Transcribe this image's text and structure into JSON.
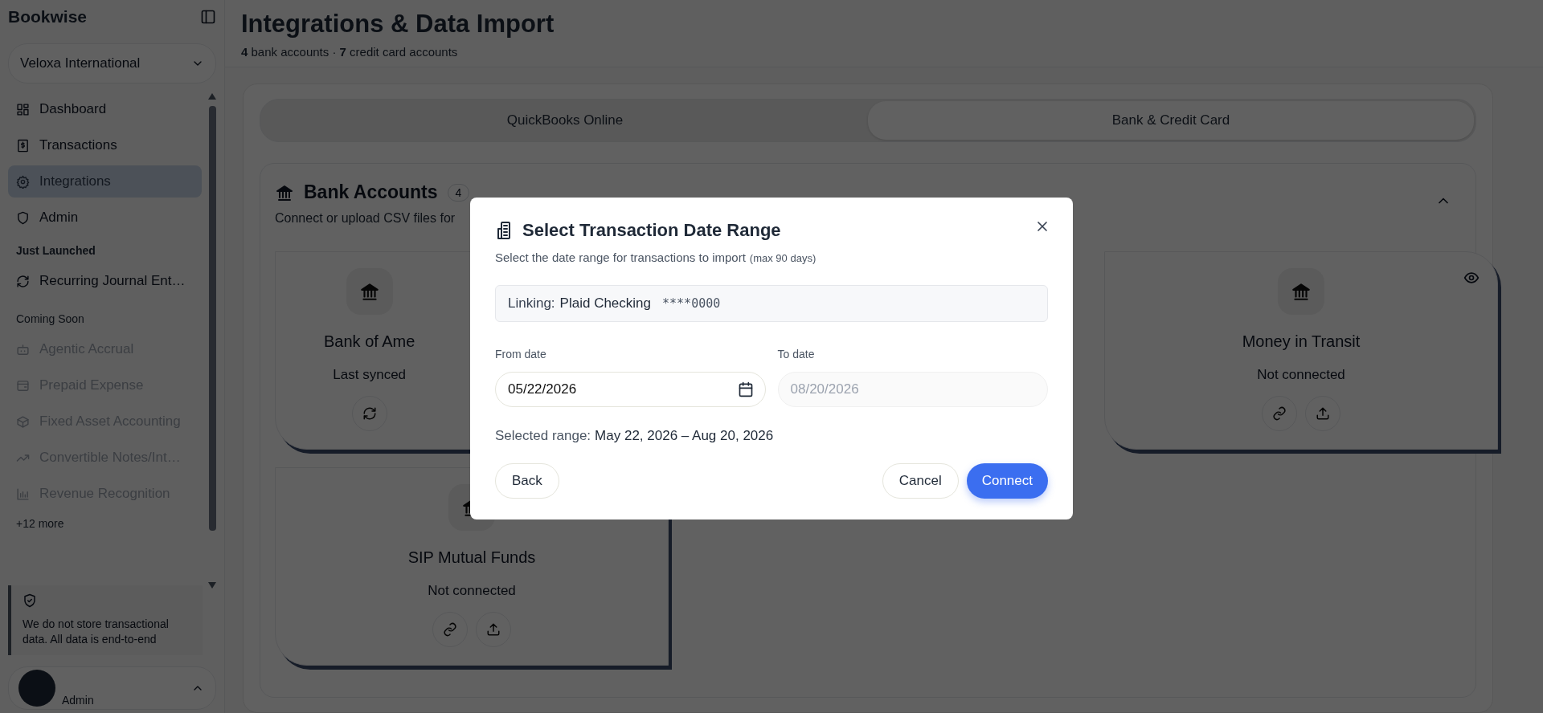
{
  "sidebar": {
    "logo": "Bookwise",
    "organization": "Veloxa International",
    "items": [
      {
        "kind": "link",
        "label": "Dashboard",
        "selected": false,
        "disabled": false
      },
      {
        "kind": "link",
        "label": "Transactions",
        "selected": false,
        "disabled": false
      },
      {
        "kind": "link",
        "label": "Integrations",
        "selected": true,
        "disabled": false
      },
      {
        "kind": "link",
        "label": "Admin",
        "selected": false,
        "disabled": false
      },
      {
        "kind": "heading",
        "label": "Just Launched"
      },
      {
        "kind": "link",
        "label": "Recurring Journal Ent…",
        "selected": false,
        "disabled": false
      },
      {
        "kind": "subheading",
        "label": "Coming Soon"
      },
      {
        "kind": "link",
        "label": "Agentic Accrual",
        "selected": false,
        "disabled": true
      },
      {
        "kind": "link",
        "label": "Prepaid Expense",
        "selected": false,
        "disabled": true
      },
      {
        "kind": "link",
        "label": "Fixed Asset Accounting",
        "selected": false,
        "disabled": true
      },
      {
        "kind": "link",
        "label": "Convertible Notes/Int…",
        "selected": false,
        "disabled": true
      },
      {
        "kind": "link",
        "label": "Revenue Recognition",
        "selected": false,
        "disabled": true
      },
      {
        "kind": "more",
        "label": "+12 more"
      }
    ],
    "notice": "We do not store transactional data. All data is end-to-end",
    "user": {
      "role": "Admin"
    }
  },
  "page": {
    "title": "Integrations & Data Import",
    "subtitle": "**4** bank accounts · **7** credit card accounts"
  },
  "tabs": [
    {
      "label": "QuickBooks Online",
      "selected": false
    },
    {
      "label": "Bank & Credit Card",
      "selected": true
    }
  ],
  "bank_accounts": {
    "title": "Bank Accounts",
    "count": "4",
    "description": "Connect or upload CSV files for",
    "expanded": true,
    "cards": [
      {
        "kind": "synced",
        "name": "Bank of Ame",
        "status": "Last synced"
      },
      {
        "kind": "unlinked",
        "name": "Money in Transit",
        "status": "Not connected"
      },
      {
        "kind": "unlinked",
        "name": "SIP Mutual Funds",
        "status": "Not connected"
      }
    ]
  },
  "modal": {
    "title": "Select Transaction Date Range",
    "subtitle": "Select the date range for transactions to import",
    "hint": "(max 90 days)",
    "linking_label": "Linking:",
    "linking_account": "Plaid Checking",
    "linking_mask": "****0000",
    "from_label": "From date",
    "from_value": "05/22/2026",
    "from_disabled": false,
    "to_label": "To date",
    "to_value": "08/20/2026",
    "to_disabled": true,
    "range_label": "Selected range:",
    "range_value": "May 22, 2026 – Aug 20, 2026",
    "buttons": [
      {
        "kind": "secondary",
        "label": "Back"
      },
      {
        "kind": "secondary",
        "label": "Cancel"
      },
      {
        "kind": "primary",
        "label": "Connect"
      }
    ]
  }
}
